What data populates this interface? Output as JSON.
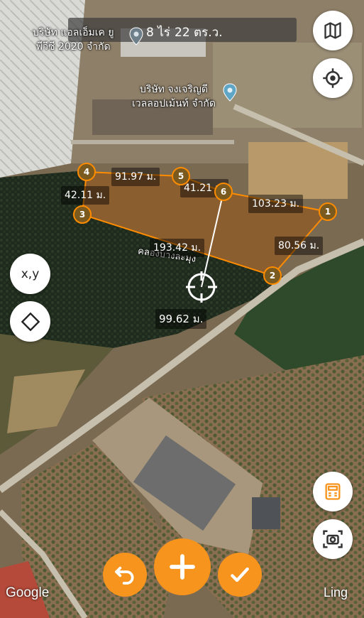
{
  "map": {
    "area_rai": "8 ไร่",
    "area_wa": "22 ตร.ว.",
    "places": [
      {
        "line1": "บริษัท แอลเอ็มเค ยู",
        "line2": "พีวีซี 2020 จำกัด"
      },
      {
        "line1": "บริษัท จงเจริญดี",
        "line2": "เวลลอปเม้นท์ จำกัด"
      }
    ],
    "canal_label": "คลองบางละมุง",
    "distances": {
      "d45": "91.97 ม.",
      "d34": "42.11 ม.",
      "d56": "41.21 ม.",
      "d61": "103.23 ม.",
      "d23": "193.42 ม.",
      "d12": "80.56 ม.",
      "cursor": "99.62 ม."
    },
    "vertices": [
      "1",
      "2",
      "3",
      "4",
      "5",
      "6"
    ],
    "polygon_color": "#ff8c00"
  },
  "buttons": {
    "coords_label": "x,y",
    "map_layers": "map-icon",
    "locate": "crosshair-icon",
    "diamond": "diamond-icon",
    "calculator": "calculator-icon",
    "screenshot": "camera-icon",
    "undo": "undo-icon",
    "add": "plus-icon",
    "confirm": "check-icon"
  },
  "branding": {
    "google": "Google",
    "app": "Ling"
  }
}
